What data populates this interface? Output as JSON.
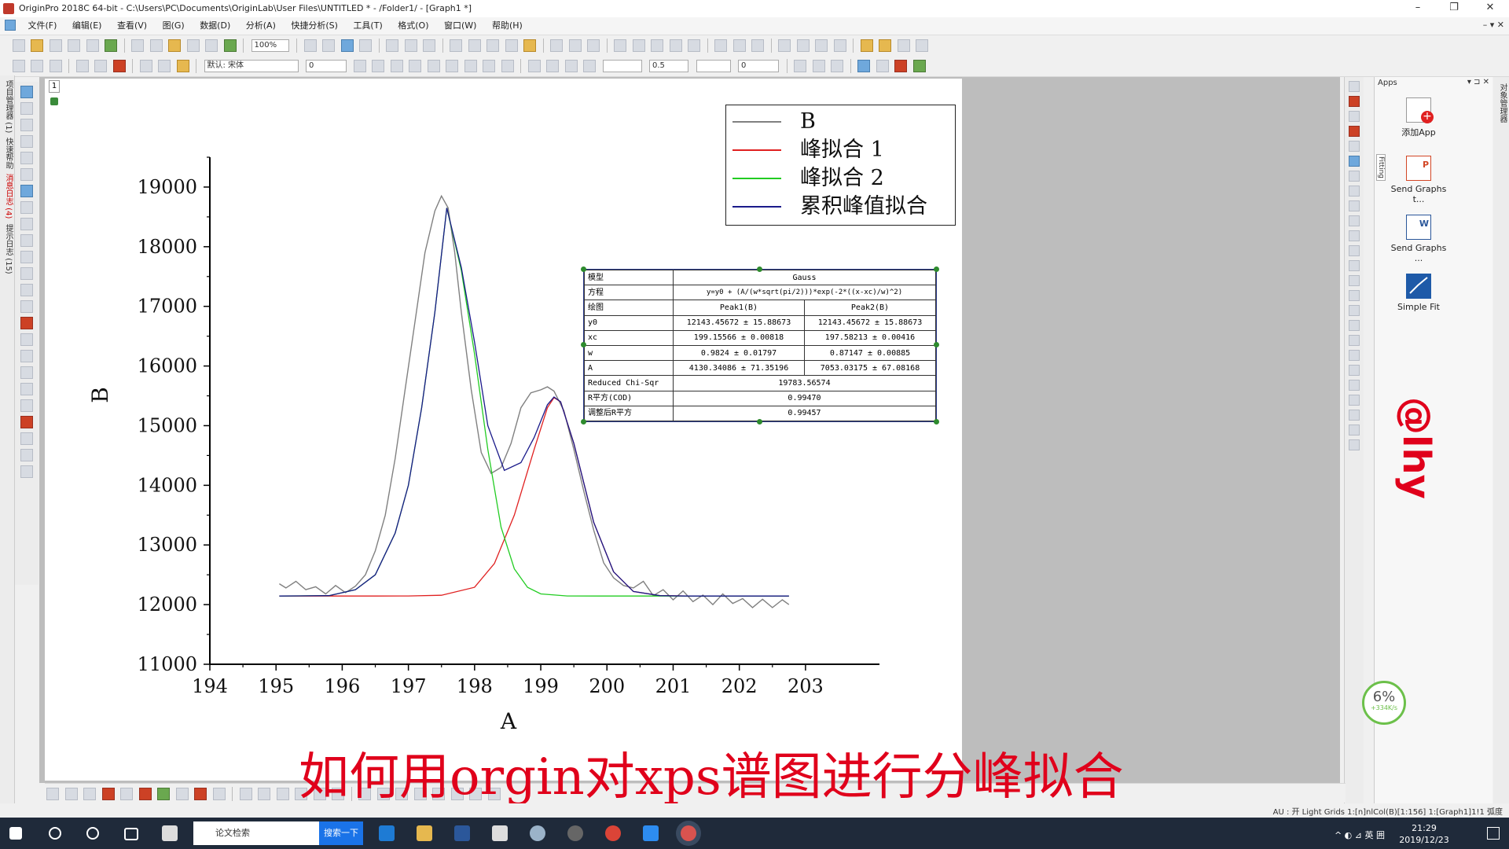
{
  "window": {
    "title": "OriginPro 2018C 64-bit - C:\\Users\\PC\\Documents\\OriginLab\\User Files\\UNTITLED * - /Folder1/ - [Graph1 *]",
    "minimize": "–",
    "maximize": "❐",
    "close": "✕",
    "mdi_controls": "– ▾ ✕"
  },
  "menu": [
    "文件(F)",
    "编辑(E)",
    "查看(V)",
    "图(G)",
    "数据(D)",
    "分析(A)",
    "快捷分析(S)",
    "工具(T)",
    "格式(O)",
    "窗口(W)",
    "帮助(H)"
  ],
  "toolbar1": {
    "zoom": "100%"
  },
  "toolbar2": {
    "font": "默认: 宋体",
    "font_size": "0",
    "line_width": "0.5",
    "value2": "0"
  },
  "left_panel_tabs": [
    {
      "label": "项目管理器 (1)",
      "red": false
    },
    {
      "label": "快速帮助",
      "red": false
    },
    {
      "label": "消息日志 (4)",
      "red": true
    },
    {
      "label": "提示日志 (15)",
      "red": false
    }
  ],
  "graph": {
    "layer_number": "1"
  },
  "chart_data": {
    "type": "line",
    "xlabel": "A",
    "ylabel": "B",
    "xlim": [
      194,
      203.5
    ],
    "ylim": [
      11000,
      19500
    ],
    "x_ticks": [
      "194",
      "195",
      "196",
      "197",
      "198",
      "199",
      "200",
      "201",
      "202",
      "203"
    ],
    "y_ticks": [
      "11000",
      "12000",
      "13000",
      "14000",
      "15000",
      "16000",
      "17000",
      "18000",
      "19000"
    ],
    "series": [
      {
        "name": "B",
        "color": "#808080",
        "x": [
          195.05,
          195.15,
          195.3,
          195.45,
          195.6,
          195.75,
          195.9,
          196.05,
          196.2,
          196.35,
          196.5,
          196.65,
          196.8,
          196.95,
          197.1,
          197.25,
          197.4,
          197.5,
          197.6,
          197.7,
          197.8,
          197.95,
          198.1,
          198.25,
          198.4,
          198.55,
          198.7,
          198.85,
          199.0,
          199.1,
          199.2,
          199.35,
          199.5,
          199.65,
          199.8,
          199.95,
          200.1,
          200.25,
          200.4,
          200.55,
          200.7,
          200.85,
          201.0,
          201.15,
          201.3,
          201.45,
          201.6,
          201.75,
          201.9,
          202.05,
          202.2,
          202.35,
          202.5,
          202.65,
          202.75
        ],
        "y": [
          12350,
          12280,
          12390,
          12250,
          12300,
          12180,
          12320,
          12200,
          12310,
          12500,
          12900,
          13500,
          14450,
          15600,
          16750,
          17900,
          18600,
          18850,
          18650,
          17900,
          16900,
          15600,
          14550,
          14200,
          14300,
          14700,
          15300,
          15550,
          15600,
          15650,
          15580,
          15250,
          14600,
          13900,
          13250,
          12700,
          12450,
          12320,
          12280,
          12390,
          12150,
          12250,
          12080,
          12230,
          12050,
          12160,
          12000,
          12180,
          12020,
          12100,
          11950,
          12090,
          11950,
          12080,
          12000
        ]
      },
      {
        "name": "峰拟合 1",
        "color": "#e02020",
        "x": [
          195.05,
          196.0,
          196.5,
          197.0,
          197.5,
          198.0,
          198.3,
          198.6,
          198.9,
          199.1,
          199.2,
          199.3,
          199.5,
          199.8,
          200.1,
          200.4,
          200.8,
          201.2,
          202.0,
          202.75
        ],
        "y": [
          12144,
          12144,
          12144,
          12145,
          12157,
          12290,
          12690,
          13500,
          14600,
          15300,
          15470,
          15400,
          14700,
          13380,
          12550,
          12220,
          12150,
          12144,
          12144,
          12144
        ]
      },
      {
        "name": "峰拟合 2",
        "color": "#22cc22",
        "x": [
          195.05,
          195.8,
          196.2,
          196.5,
          196.8,
          197.0,
          197.2,
          197.4,
          197.58,
          197.8,
          198.0,
          198.2,
          198.4,
          198.6,
          198.8,
          199.0,
          199.4,
          200.0,
          201.0,
          202.75
        ],
        "y": [
          12144,
          12150,
          12250,
          12500,
          13200,
          14000,
          15300,
          16900,
          18650,
          17600,
          16200,
          14600,
          13300,
          12600,
          12290,
          12180,
          12145,
          12144,
          12144,
          12144
        ]
      },
      {
        "name": "累积峰值拟合",
        "color": "#1a1a8a",
        "x": [
          195.05,
          195.8,
          196.2,
          196.5,
          196.8,
          197.0,
          197.2,
          197.4,
          197.58,
          197.8,
          198.0,
          198.2,
          198.45,
          198.7,
          198.9,
          199.1,
          199.2,
          199.3,
          199.5,
          199.8,
          200.1,
          200.4,
          200.8,
          201.2,
          202.0,
          202.75
        ],
        "y": [
          12144,
          12150,
          12250,
          12500,
          13200,
          14000,
          15300,
          16900,
          18650,
          17650,
          16400,
          15000,
          14250,
          14380,
          14800,
          15350,
          15480,
          15400,
          14700,
          13380,
          12550,
          12220,
          12150,
          12144,
          12144,
          12144
        ]
      }
    ]
  },
  "fit_table": {
    "model_label": "模型",
    "model_value": "Gauss",
    "equation_label": "方程",
    "equation_value": "y=y0 + (A/(w*sqrt(pi/2)))*exp(-2*((x-xc)/w)^2)",
    "plot_label": "绘图",
    "peak1": "Peak1(B)",
    "peak2": "Peak2(B)",
    "rows": [
      {
        "param": "y0",
        "p1": "12143.45672 ± 15.88673",
        "p2": "12143.45672 ± 15.88673"
      },
      {
        "param": "xc",
        "p1": "199.15566 ± 0.00818",
        "p2": "197.58213 ± 0.00416"
      },
      {
        "param": "w",
        "p1": "0.9824 ± 0.01797",
        "p2": "0.87147 ± 0.00885"
      },
      {
        "param": "A",
        "p1": "4130.34086 ± 71.35196",
        "p2": "7053.03175 ± 67.08168"
      }
    ],
    "chisqr_label": "Reduced Chi-Sqr",
    "chisqr_value": "19783.56574",
    "cod_label": "R平方(COD)",
    "cod_value": "0.99470",
    "adjr2_label": "调整后R平方",
    "adjr2_value": "0.99457"
  },
  "apps_panel": {
    "title": "Apps",
    "controls": "▾ ⊐ ✕",
    "fitting_tab": "Fitting",
    "items": [
      {
        "label": "添加App",
        "icon": "add-app-icon"
      },
      {
        "label": "Send Graphs t...",
        "icon": "send-ppt-icon"
      },
      {
        "label": "Send Graphs ...",
        "icon": "send-word-icon"
      },
      {
        "label": "Simple Fit",
        "icon": "simple-fit-icon"
      }
    ]
  },
  "far_right_tab": "对象管理器",
  "watermark": "@lhy",
  "caption": "如何用orgin对xps谱图进行分峰拟合",
  "net_widget": {
    "percent": "6%",
    "speed": "+334K/s"
  },
  "status_bar": "AU : 开  Light Grids  1:[n]nlCol(B)[1:156]  1:[Graph1]1!1  弧度",
  "taskbar": {
    "search_text": "论文检索",
    "search_button": "搜索一下",
    "tray_text": "^ ◐ ⊿ 英 囲",
    "time": "21:29",
    "date": "2019/12/23"
  },
  "colors": {
    "caption": "#e0001b",
    "taskbar": "#1f2a3a",
    "table_border": "#2a3a8a"
  }
}
